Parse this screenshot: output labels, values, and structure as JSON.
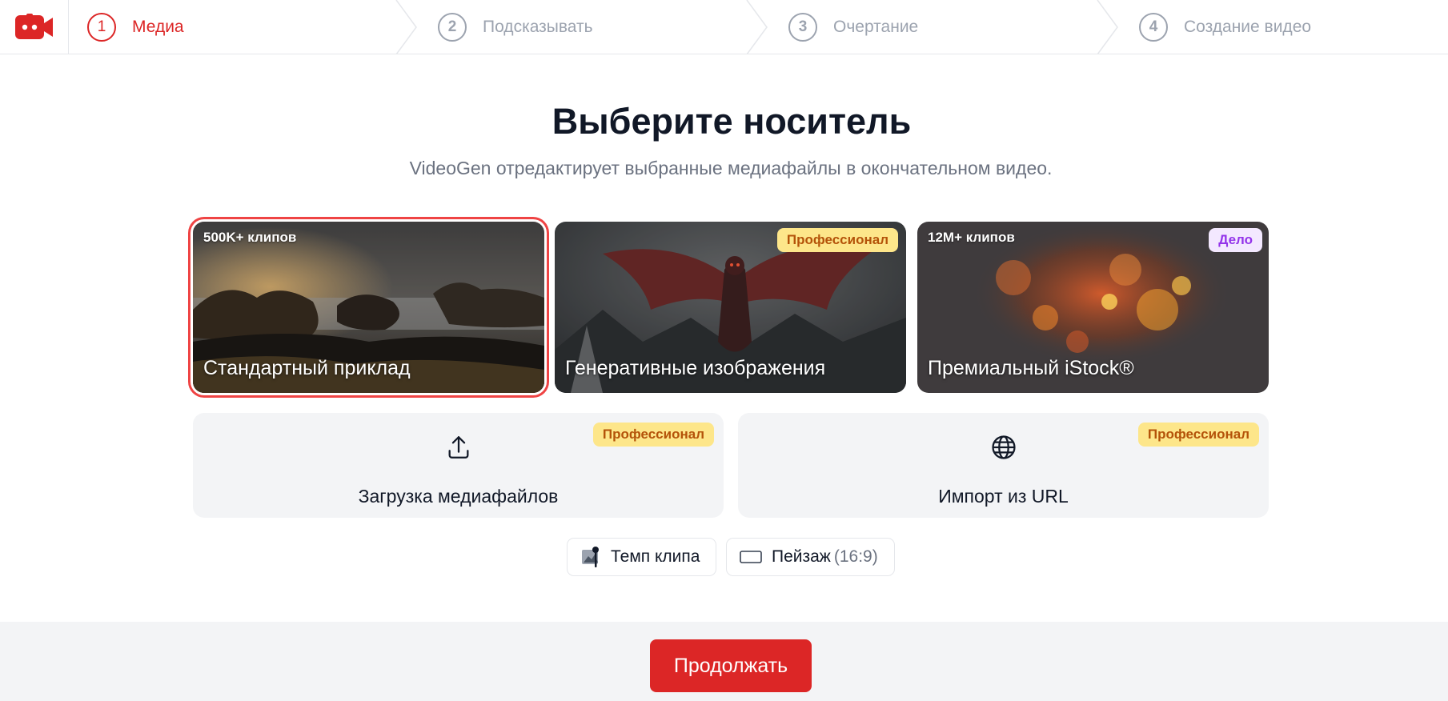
{
  "stepper": {
    "steps": [
      {
        "num": "1",
        "label": "Медиа",
        "active": true
      },
      {
        "num": "2",
        "label": "Подсказывать"
      },
      {
        "num": "3",
        "label": "Очертание"
      },
      {
        "num": "4",
        "label": "Создание видео"
      }
    ]
  },
  "main": {
    "title": "Выберите носитель",
    "subtitle": "VideoGen отредактирует выбранные медиафайлы в окончательном видео."
  },
  "media_cards": [
    {
      "count": "500K+ клипов",
      "title": "Стандартный приклад",
      "selected": true
    },
    {
      "badge": "Профессионал",
      "title": "Генеративные изображения"
    },
    {
      "count": "12M+ клипов",
      "badge": "Дело",
      "title": "Премиальный iStock®"
    }
  ],
  "tiles": {
    "upload": {
      "label": "Загрузка медиафайлов",
      "badge": "Профессионал",
      "icon": "upload-icon"
    },
    "url": {
      "label": "Импорт из URL",
      "badge": "Профессионал",
      "icon": "globe-icon"
    }
  },
  "options": {
    "clip_pace": {
      "label": "Темп клипа",
      "icon": "clip-pace-icon"
    },
    "aspect": {
      "label": "Пейзаж",
      "ratio": "(16:9)",
      "icon": "landscape-icon"
    }
  },
  "footer": {
    "continue_label": "Продолжать"
  },
  "colors": {
    "accent": "#dc2626",
    "pro_badge_bg": "#fde68a",
    "pro_badge_text": "#b45309",
    "biz_badge_bg": "#f3e8ff",
    "biz_badge_text": "#9333ea"
  }
}
